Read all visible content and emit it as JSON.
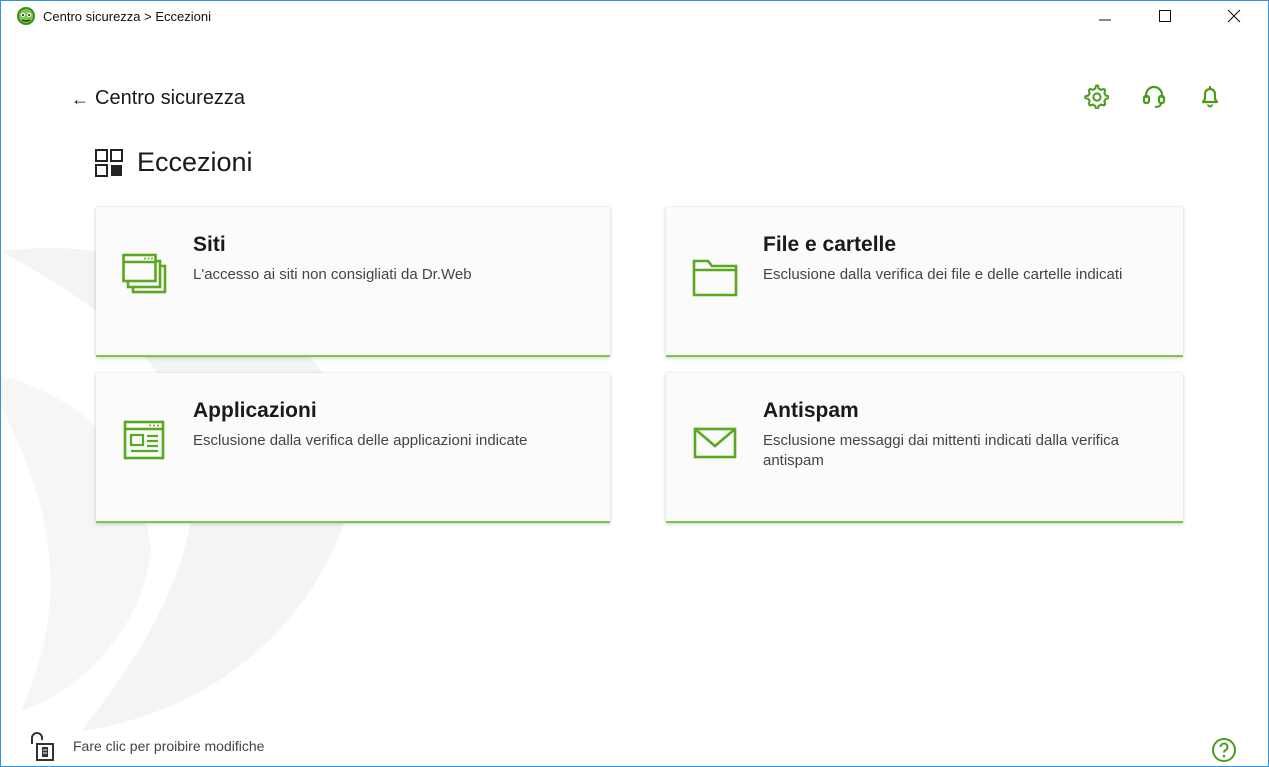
{
  "window": {
    "title": "Centro sicurezza > Eccezioni",
    "minimize_icon": "minimize-icon",
    "maximize_icon": "maximize-icon",
    "close_icon": "close-icon"
  },
  "navigation": {
    "back_label": "Centro sicurezza",
    "back_icon": "arrow-left-icon"
  },
  "toolbar": {
    "icons": [
      "gear-icon",
      "support-headset-icon",
      "bell-icon"
    ]
  },
  "page": {
    "title": "Eccezioni",
    "icon": "grid-icon"
  },
  "cards": [
    {
      "title": "Siti",
      "description": "L'accesso ai siti non consigliati da Dr.Web",
      "icon": "browser-windows-icon"
    },
    {
      "title": "File e cartelle",
      "description": "Esclusione dalla verifica dei file e delle cartelle indicati",
      "icon": "folder-icon"
    },
    {
      "title": "Applicazioni",
      "description": "Esclusione dalla verifica delle applicazioni indicate",
      "icon": "application-window-icon"
    },
    {
      "title": "Antispam",
      "description": "Esclusione messaggi dai mittenti indicati dalla verifica antispam",
      "icon": "envelope-icon"
    }
  ],
  "footer": {
    "lock_text": "Fare clic per proibire modifiche",
    "lock_icon": "unlocked-padlock-icon",
    "help_icon": "help-icon"
  },
  "colors": {
    "accent": "#6ab42e",
    "window_border": "#3b8fd6",
    "card_background": "#fbfbfb"
  }
}
